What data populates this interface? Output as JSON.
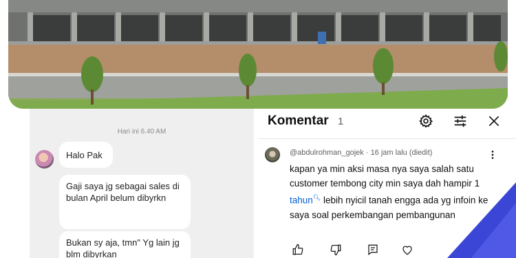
{
  "chat": {
    "timestamp": "Hari ini 6.40 AM",
    "messages": [
      "Halo Pak",
      "Gaji saya jg sebagai sales di bulan April belum dibyrkn",
      "Bukan sy aja, tmn\" Yg lain jg blm dibyrkan"
    ]
  },
  "comments": {
    "title": "Komentar",
    "count": "1",
    "icons": [
      "settings-icon",
      "sliders-icon",
      "close-icon"
    ],
    "comment": {
      "meta": "@abdulrohman_gojek · 16 jam lalu (diedit)",
      "text_before": "kapan ya min aksi masa nya saya salah satu customer tembong city min saya dah hampir 1 ",
      "link": "tahun",
      "text_after": " lebih nyicil tanah engga ada yg infoin ke saya soal perkembangan pembangunan",
      "actions": [
        "thumbs-up-icon",
        "thumbs-down-icon",
        "reply-icon",
        "heart-icon"
      ]
    }
  },
  "colors": {
    "link": "#065fd4",
    "chat_bg": "#efefef",
    "corner": "#3b46d6"
  }
}
